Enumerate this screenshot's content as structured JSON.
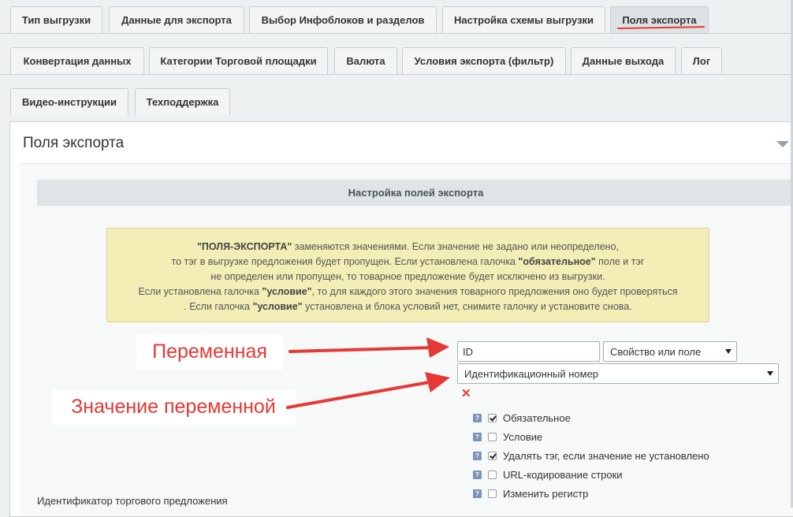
{
  "tabs_row1": [
    {
      "label": "Тип выгрузки",
      "active": false
    },
    {
      "label": "Данные для экспорта",
      "active": false
    },
    {
      "label": "Выбор Инфоблоков и разделов",
      "active": false
    },
    {
      "label": "Настройка схемы выгрузки",
      "active": false
    },
    {
      "label": "Поля экспорта",
      "active": true
    }
  ],
  "tabs_row2": [
    {
      "label": "Конвертация данных"
    },
    {
      "label": "Категории Торговой площадки"
    },
    {
      "label": "Валюта"
    },
    {
      "label": "Условия экспорта (фильтр)"
    },
    {
      "label": "Данные выхода"
    },
    {
      "label": "Лог"
    }
  ],
  "tabs_row3": [
    {
      "label": "Видео-инструкции"
    },
    {
      "label": "Техподдержка"
    }
  ],
  "panel": {
    "title": "Поля экспорта",
    "section_title": "Настройка полей экспорта"
  },
  "note": {
    "l1_b": "\"ПОЛЯ-ЭКСПОРТА\"",
    "l1": " заменяются значениями. Если значение не задано или неопределено,",
    "l2a": "то тэг в выгрузке предложения будет пропущен. Если установлена галочка ",
    "l2_b": "\"обязательное\"",
    "l2c": " поле и тэг",
    "l3": "не определен или пропущен, то товарное предложение будет исключено из выгрузки.",
    "l4a": "Если установлена галочка ",
    "l4_b": "\"условие\"",
    "l4c": ", то для каждого этого значения товарного предложения оно будет проверяться",
    "l5a": ". Если галочка ",
    "l5_b": "\"условие\"",
    "l5c": " установлена и блока условий нет, снимите галочку и установите снова."
  },
  "field": {
    "variable_value": "ID",
    "source_select": "Свойство или поле",
    "value_select": "Идентификационный номер",
    "delete_icon": "✕"
  },
  "options": [
    {
      "label": "Обязательное",
      "checked": true
    },
    {
      "label": "Условие",
      "checked": false
    },
    {
      "label": "Удалять тэг, если значение не установлено",
      "checked": true
    },
    {
      "label": "URL-кодирование строки",
      "checked": false
    },
    {
      "label": "Изменить регистр",
      "checked": false
    }
  ],
  "help_icon": "?",
  "row_label": "Идентификатор торгового предложения",
  "annotations": {
    "variable": "Переменная",
    "value": "Значение переменной",
    "color": "#e53935"
  }
}
